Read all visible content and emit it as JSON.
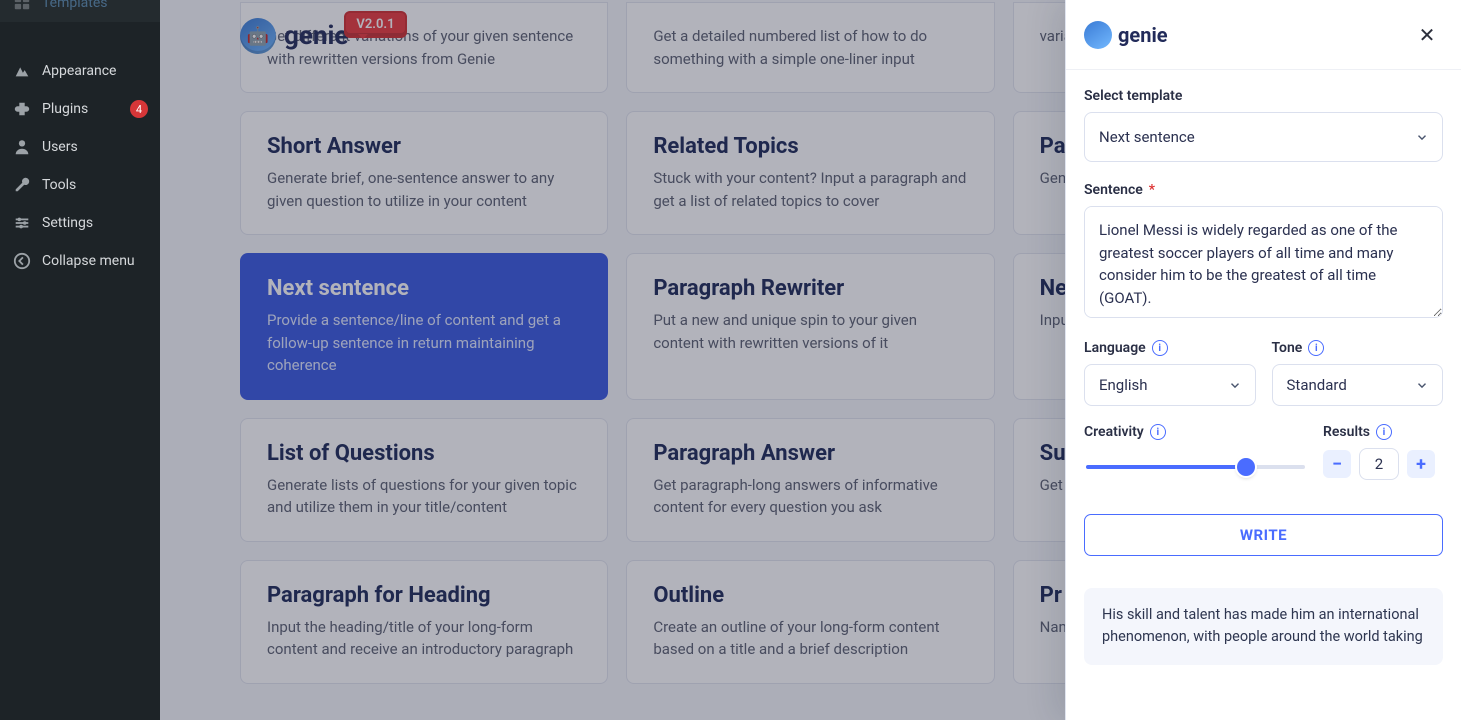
{
  "brand": {
    "name": "genie",
    "version": "V2.0.1"
  },
  "wp_sidebar": {
    "items": [
      {
        "label": "Templates",
        "icon": "templates"
      },
      {
        "label": "Appearance",
        "icon": "appearance"
      },
      {
        "label": "Plugins",
        "icon": "plugins",
        "badge": "4"
      },
      {
        "label": "Users",
        "icon": "users"
      },
      {
        "label": "Tools",
        "icon": "tools"
      },
      {
        "label": "Settings",
        "icon": "settings"
      },
      {
        "label": "Collapse menu",
        "icon": "collapse"
      }
    ]
  },
  "cards": [
    {
      "title": "",
      "desc": "Get different variations of your given sentence with rewritten versions from Genie"
    },
    {
      "title": "",
      "desc": "Get a detailed numbered list of how to do something with a simple one-liner input"
    },
    {
      "title": "",
      "desc": "varia"
    },
    {
      "title": "Short Answer",
      "desc": "Generate brief, one-sentence answer to any given question to utilize in your content"
    },
    {
      "title": "Related Topics",
      "desc": "Stuck with your content? Input a paragraph and get a list of related topics to cover"
    },
    {
      "title": "Pa",
      "desc": "Gen the"
    },
    {
      "title": "Next sentence",
      "desc": "Provide a sentence/line of content and get a follow-up sentence in return maintaining coherence",
      "active": true
    },
    {
      "title": "Paragraph Rewriter",
      "desc": "Put a new and unique spin to your given content with rewritten versions of it"
    },
    {
      "title": "Ne",
      "desc": "Inpu cont"
    },
    {
      "title": "List of Questions",
      "desc": "Generate lists of questions for your given topic and utilize them in your title/content"
    },
    {
      "title": "Paragraph Answer",
      "desc": "Get paragraph-long answers of informative content for every question you ask"
    },
    {
      "title": "Su",
      "desc": "Get with"
    },
    {
      "title": "Paragraph for Heading",
      "desc": "Input the heading/title of your long-form content and receive an introductory paragraph"
    },
    {
      "title": "Outline",
      "desc": "Create an outline of your long-form content based on a title and a brief description"
    },
    {
      "title": "Pr",
      "desc": "Nam writ"
    }
  ],
  "panel": {
    "select_template_label": "Select template",
    "template_value": "Next sentence",
    "sentence_label": "Sentence",
    "sentence_value": "Lionel Messi is widely regarded as one of the greatest soccer players of all time and many consider him to be the greatest of all time (GOAT).",
    "language_label": "Language",
    "language_value": "English",
    "tone_label": "Tone",
    "tone_value": "Standard",
    "creativity_label": "Creativity",
    "creativity_value": 4,
    "creativity_max": 5,
    "results_label": "Results",
    "results_value": "2",
    "write_label": "WRITE",
    "result_text": "His skill and talent has made him an international phenomenon, with people around the world taking"
  }
}
